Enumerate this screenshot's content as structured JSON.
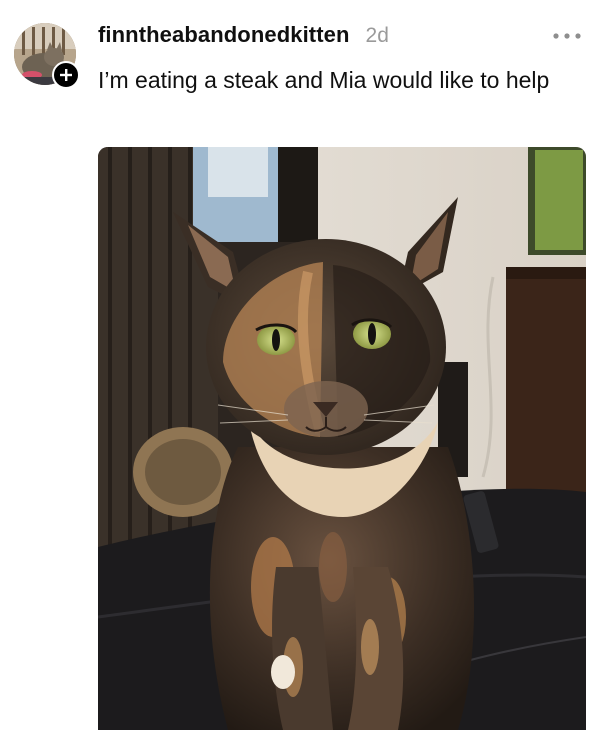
{
  "post": {
    "username": "finntheabandonedkitten",
    "time": "2d",
    "caption": "I’m eating a steak and Mia would like to help",
    "more_icon": "ellipsis-icon",
    "follow_icon": "plus-icon",
    "photo_subject": "tortoiseshell-cat"
  },
  "colors": {
    "text": "#101010",
    "muted": "#9a9a9a",
    "badge": "#000000"
  }
}
